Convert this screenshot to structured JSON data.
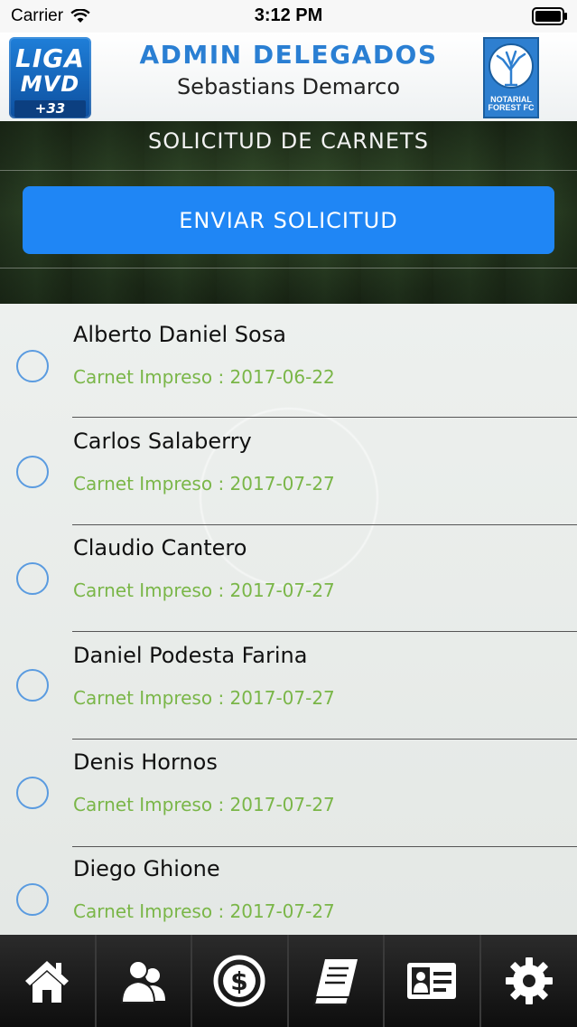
{
  "status_bar": {
    "carrier": "Carrier",
    "time": "3:12 PM"
  },
  "header": {
    "title": "ADMIN DELEGADOS",
    "subtitle": "Sebastians Demarco",
    "league_logo": {
      "line1": "LIGA",
      "line2": "MVD",
      "line3": "+33"
    },
    "club_logo": {
      "line1": "NOTARIAL",
      "line2": "FOREST FC"
    }
  },
  "banner": {
    "title": "SOLICITUD DE CARNETS",
    "button_label": "ENVIAR SOLICITUD"
  },
  "players": [
    {
      "name": "Alberto Daniel Sosa",
      "status": "Carnet Impreso : 2017-06-22"
    },
    {
      "name": "Carlos Salaberry",
      "status": "Carnet Impreso : 2017-07-27"
    },
    {
      "name": "Claudio Cantero",
      "status": "Carnet Impreso : 2017-07-27"
    },
    {
      "name": "Daniel Podesta Farina",
      "status": "Carnet Impreso : 2017-07-27"
    },
    {
      "name": "Denis Hornos",
      "status": "Carnet Impreso : 2017-07-27"
    },
    {
      "name": "Diego Ghione",
      "status": "Carnet Impreso : 2017-07-27"
    }
  ],
  "tabs": [
    {
      "icon": "home-icon"
    },
    {
      "icon": "users-icon"
    },
    {
      "icon": "dollar-icon"
    },
    {
      "icon": "book-icon"
    },
    {
      "icon": "id-card-icon"
    },
    {
      "icon": "gear-icon"
    }
  ],
  "colors": {
    "accent": "#1f86f5",
    "title_blue": "#2a7fd3",
    "status_green": "#7ab648",
    "radio_blue": "#5a9be0"
  }
}
